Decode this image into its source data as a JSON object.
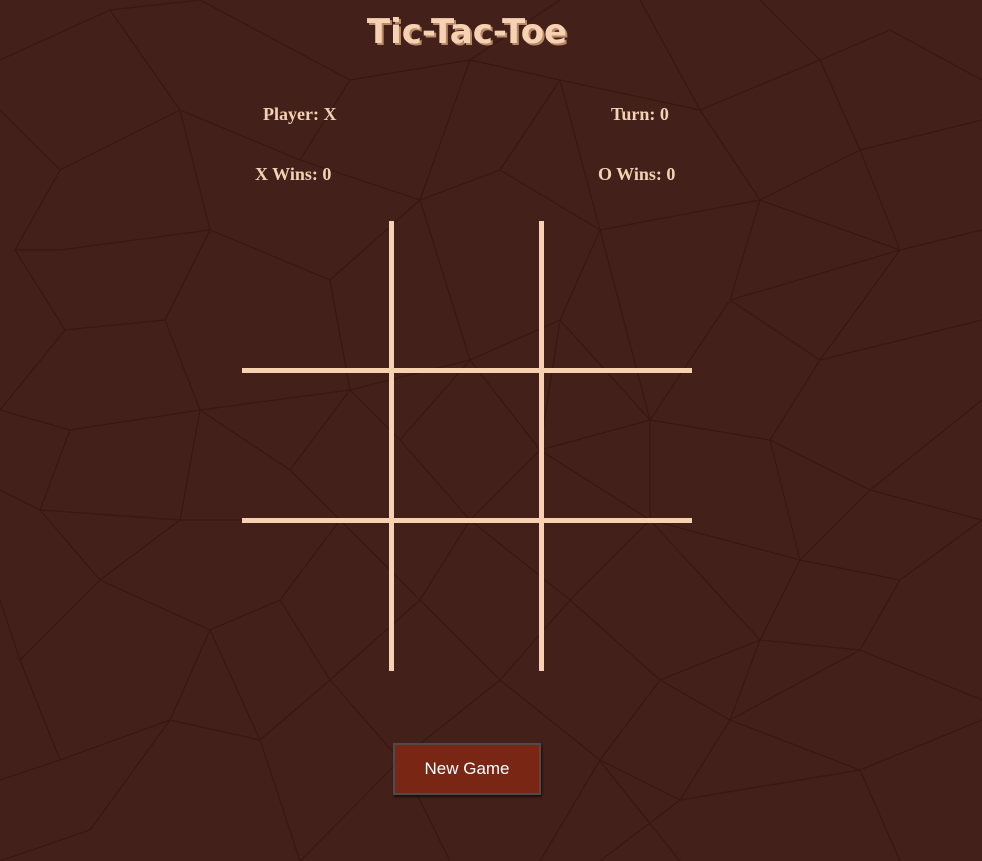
{
  "title": "Tic-Tac-Toe",
  "status": {
    "player_label": "Player: X",
    "turn_label": "Turn: 0",
    "x_wins_label": "X Wins: 0",
    "o_wins_label": "O Wins: 0"
  },
  "board": {
    "cells": [
      "",
      "",
      "",
      "",
      "",
      "",
      "",
      "",
      ""
    ]
  },
  "new_game_label": "New Game",
  "colors": {
    "background": "#43201a",
    "pattern_line": "#3a1913",
    "accent": "#f8d2b0",
    "button": "#7a2615"
  }
}
